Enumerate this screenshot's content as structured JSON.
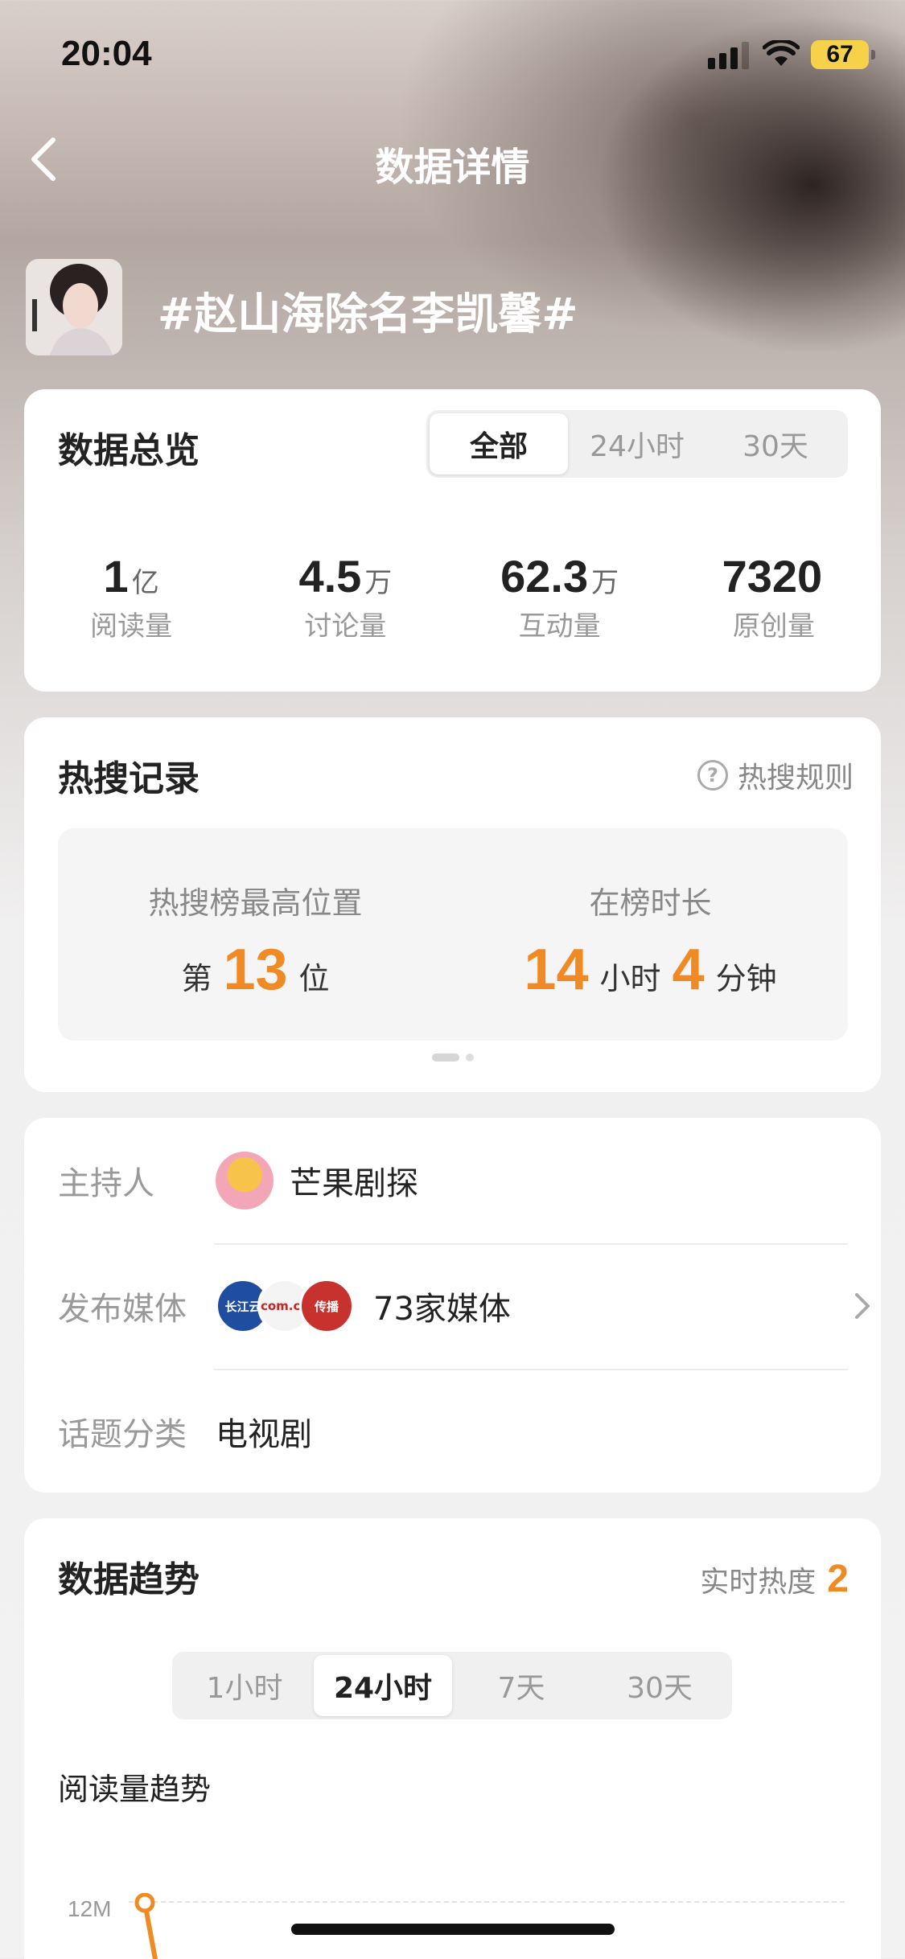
{
  "status_bar": {
    "time": "20:04",
    "battery": "67"
  },
  "nav": {
    "title": "数据详情"
  },
  "topic": {
    "title": "#赵山海除名李凯馨#"
  },
  "overview": {
    "title": "数据总览",
    "tabs": [
      "全部",
      "24小时",
      "30天"
    ],
    "active_tab": "全部",
    "stats": [
      {
        "value": "1",
        "unit": "亿",
        "label": "阅读量"
      },
      {
        "value": "4.5",
        "unit": "万",
        "label": "讨论量"
      },
      {
        "value": "62.3",
        "unit": "万",
        "label": "互动量"
      },
      {
        "value": "7320",
        "unit": "",
        "label": "原创量"
      }
    ]
  },
  "hot_search": {
    "title": "热搜记录",
    "rules_link": "热搜规则",
    "peak_label": "热搜榜最高位置",
    "peak_prefix": "第",
    "peak_value": "13",
    "peak_suffix": "位",
    "duration_label": "在榜时长",
    "hours_value": "14",
    "hours_unit": "小时",
    "minutes_value": "4",
    "minutes_unit": "分钟"
  },
  "info": {
    "host_key": "主持人",
    "host_name": "芒果剧探",
    "media_key": "发布媒体",
    "media_value": "73家媒体",
    "category_key": "话题分类",
    "category_value": "电视剧"
  },
  "trend": {
    "title": "数据趋势",
    "realtime_label": "实时热度",
    "realtime_value": "2",
    "tabs": [
      "1小时",
      "24小时",
      "7天",
      "30天"
    ],
    "active_tab": "24小时",
    "chart_title": "阅读量趋势",
    "y_tick": "12M"
  },
  "colors": {
    "accent": "#f08a24"
  }
}
